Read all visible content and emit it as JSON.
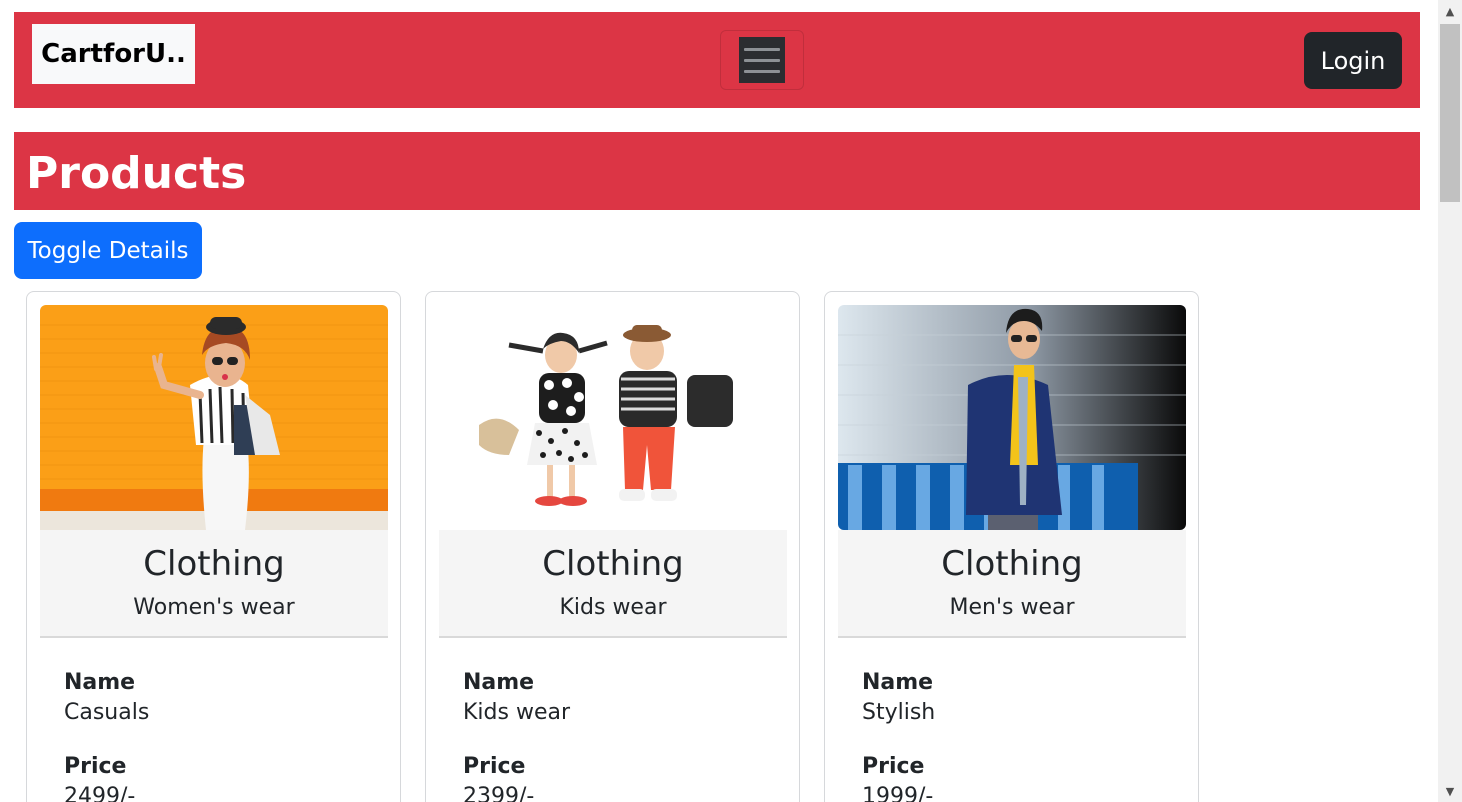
{
  "navbar": {
    "brand": "CartforU..",
    "login_label": "Login",
    "menu_icon": "hamburger-icon",
    "background_color": "#dc3545"
  },
  "page": {
    "title": "Products",
    "toggle_label": "Toggle Details",
    "toggle_color": "#0d6efd"
  },
  "products": [
    {
      "category": "Clothing",
      "subcategory": "Women's wear",
      "name_label": "Name",
      "name": "Casuals",
      "price_label": "Price",
      "price": "2499/-"
    },
    {
      "category": "Clothing",
      "subcategory": "Kids wear",
      "name_label": "Name",
      "name": "Kids wear",
      "price_label": "Price",
      "price": "2399/-"
    },
    {
      "category": "Clothing",
      "subcategory": "Men's wear",
      "name_label": "Name",
      "name": "Stylish",
      "price_label": "Price",
      "price": "1999/-"
    }
  ]
}
